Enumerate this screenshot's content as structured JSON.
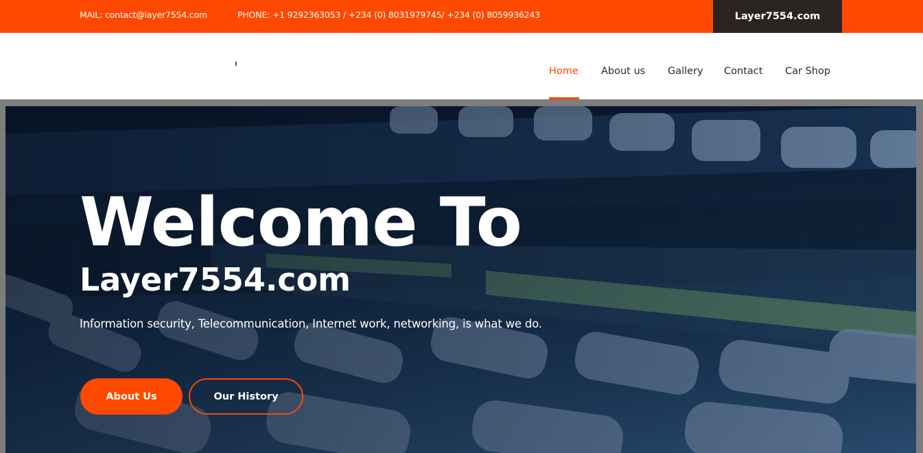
{
  "topbar": {
    "mail": "MAIL: contact@layer7554.com",
    "phone": "PHONE: +1 9292363053 / +234 (0) 8031979745/ +234 (0) 8059936243",
    "brand": "Layer7554.com"
  },
  "nav": {
    "items": [
      {
        "label": "Home",
        "active": true
      },
      {
        "label": "About us",
        "active": false
      },
      {
        "label": "Gallery",
        "active": false
      },
      {
        "label": "Contact",
        "active": false
      },
      {
        "label": "Car Shop",
        "active": false
      }
    ]
  },
  "hero": {
    "heading": "Welcome To",
    "site_name": "Layer7554.com",
    "tagline": "Information security, Telecommunication, Internet work, networking, is what we do.",
    "primary_button": "About Us",
    "secondary_button": "Our History",
    "background_image": "network-patch-panel"
  },
  "colors": {
    "accent": "#ff4800",
    "brand_box": "#2b2422"
  }
}
